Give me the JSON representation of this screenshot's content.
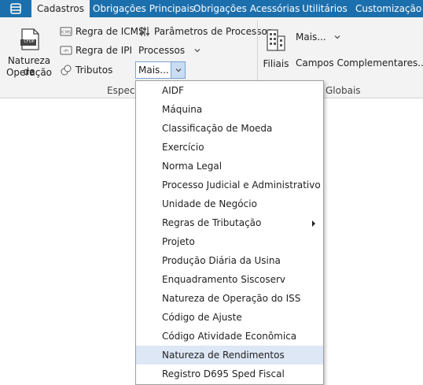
{
  "tabs": [
    {
      "label": "Cadastros",
      "active": true
    },
    {
      "label": "Obrigações Principais",
      "active": false
    },
    {
      "label": "Obrigações Acessórias",
      "active": false
    },
    {
      "label": "Utilitários",
      "active": false
    },
    {
      "label": "Customização",
      "active": false
    }
  ],
  "ribbon": {
    "natureza_line1": "Natureza de",
    "natureza_line2": "Operação",
    "cfop_badge": "CFOP",
    "regra_icms": "Regra de ICMS",
    "regra_ipi": "Regra de IPI",
    "tributos": "Tributos",
    "parametros": "Parâmetros de Processos",
    "processos": "Processos",
    "mais_selected": "Mais...",
    "filiais": "Filiais",
    "mais_right": "Mais...",
    "campos": "Campos Complementares...",
    "group_left": "Especif",
    "group_right": "Globais"
  },
  "menu": {
    "items": [
      {
        "label": "AIDF"
      },
      {
        "label": "Máquina"
      },
      {
        "label": "Classificação de Moeda"
      },
      {
        "label": "Exercício"
      },
      {
        "label": "Norma Legal"
      },
      {
        "label": "Processo Judicial e Administrativo"
      },
      {
        "label": "Unidade de Negócio"
      },
      {
        "label": "Regras de Tributação",
        "submenu": true
      },
      {
        "label": "Projeto"
      },
      {
        "label": "Produção Diária da Usina"
      },
      {
        "label": "Enquadramento Siscoserv"
      },
      {
        "label": "Natureza de Operação do ISS"
      },
      {
        "label": "Código de Ajuste"
      },
      {
        "label": "Código Atividade Econômica"
      },
      {
        "label": "Natureza de Rendimentos",
        "highlighted": true
      },
      {
        "label": "Registro D695 Sped Fiscal"
      }
    ]
  },
  "colors": {
    "tab_bar": "#1c6fad",
    "ribbon_bg": "#f3f3f3",
    "menu_highlight": "#dde7f5"
  }
}
